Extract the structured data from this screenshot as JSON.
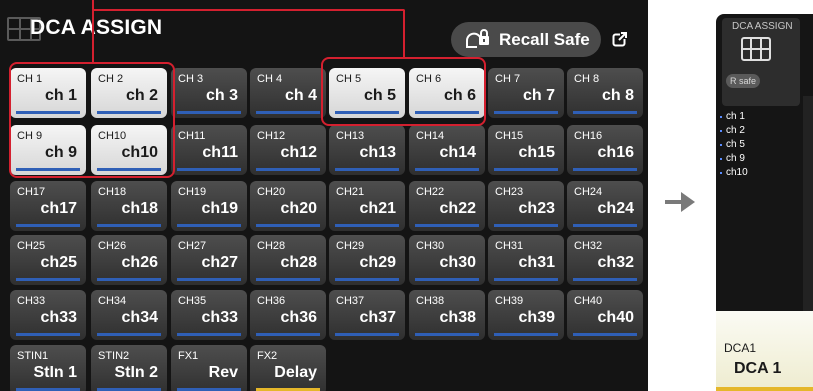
{
  "title": "DCA ASSIGN",
  "recall_safe": {
    "label": "Recall Safe",
    "icon": "lock-icon"
  },
  "popout_icon": "popout-icon",
  "channels": [
    {
      "top": "CH 1",
      "main": "ch 1",
      "selected": true
    },
    {
      "top": "CH 2",
      "main": "ch 2",
      "selected": true
    },
    {
      "top": "CH 3",
      "main": "ch 3",
      "selected": false
    },
    {
      "top": "CH 4",
      "main": "ch 4",
      "selected": false
    },
    {
      "top": "CH 5",
      "main": "ch 5",
      "selected": true
    },
    {
      "top": "CH 6",
      "main": "ch 6",
      "selected": true
    },
    {
      "top": "CH 7",
      "main": "ch 7",
      "selected": false
    },
    {
      "top": "CH 8",
      "main": "ch 8",
      "selected": false
    },
    {
      "top": "CH 9",
      "main": "ch 9",
      "selected": true
    },
    {
      "top": "CH10",
      "main": "ch10",
      "selected": true
    },
    {
      "top": "CH11",
      "main": "ch11",
      "selected": false
    },
    {
      "top": "CH12",
      "main": "ch12",
      "selected": false
    },
    {
      "top": "CH13",
      "main": "ch13",
      "selected": false
    },
    {
      "top": "CH14",
      "main": "ch14",
      "selected": false
    },
    {
      "top": "CH15",
      "main": "ch15",
      "selected": false
    },
    {
      "top": "CH16",
      "main": "ch16",
      "selected": false
    },
    {
      "top": "CH17",
      "main": "ch17",
      "selected": false
    },
    {
      "top": "CH18",
      "main": "ch18",
      "selected": false
    },
    {
      "top": "CH19",
      "main": "ch19",
      "selected": false
    },
    {
      "top": "CH20",
      "main": "ch20",
      "selected": false
    },
    {
      "top": "CH21",
      "main": "ch21",
      "selected": false
    },
    {
      "top": "CH22",
      "main": "ch22",
      "selected": false
    },
    {
      "top": "CH23",
      "main": "ch23",
      "selected": false
    },
    {
      "top": "CH24",
      "main": "ch24",
      "selected": false
    },
    {
      "top": "CH25",
      "main": "ch25",
      "selected": false
    },
    {
      "top": "CH26",
      "main": "ch26",
      "selected": false
    },
    {
      "top": "CH27",
      "main": "ch27",
      "selected": false
    },
    {
      "top": "CH28",
      "main": "ch28",
      "selected": false
    },
    {
      "top": "CH29",
      "main": "ch29",
      "selected": false
    },
    {
      "top": "CH30",
      "main": "ch30",
      "selected": false
    },
    {
      "top": "CH31",
      "main": "ch31",
      "selected": false
    },
    {
      "top": "CH32",
      "main": "ch32",
      "selected": false
    },
    {
      "top": "CH33",
      "main": "ch33",
      "selected": false
    },
    {
      "top": "CH34",
      "main": "ch34",
      "selected": false
    },
    {
      "top": "CH35",
      "main": "ch33",
      "selected": false
    },
    {
      "top": "CH36",
      "main": "ch36",
      "selected": false
    },
    {
      "top": "CH37",
      "main": "ch37",
      "selected": false
    },
    {
      "top": "CH38",
      "main": "ch38",
      "selected": false
    },
    {
      "top": "CH39",
      "main": "ch39",
      "selected": false
    },
    {
      "top": "CH40",
      "main": "ch40",
      "selected": false
    },
    {
      "top": "STIN1",
      "main": "StIn 1",
      "selected": false
    },
    {
      "top": "STIN2",
      "main": "StIn 2",
      "selected": false
    },
    {
      "top": "FX1",
      "main": "Rev",
      "selected": false
    },
    {
      "top": "FX2",
      "main": "Delay",
      "selected": false,
      "bar": "yellow"
    }
  ],
  "arrow_icon": "arrow-right-icon",
  "dca_panel": {
    "header_label": "DCA ASSIGN",
    "grid_icon": "grid-icon",
    "rsafe_label": "R safe",
    "assigned": [
      "ch 1",
      "ch 2",
      "ch 5",
      "ch 9",
      "ch10"
    ],
    "footer_top": "DCA1",
    "footer_main": "DCA 1"
  },
  "colors": {
    "panel_bg": "#141414",
    "selected_button": "#e6e6e6",
    "highlight": "#d4202f",
    "channel_bar": "#2f5fb6",
    "fx_bar": "#e5b72a"
  }
}
